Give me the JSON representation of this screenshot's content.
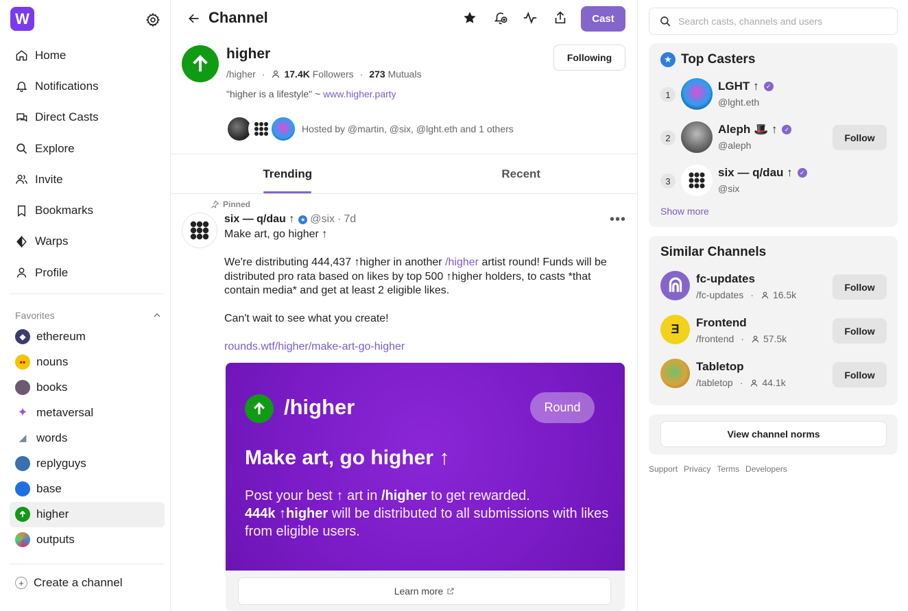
{
  "app": {
    "logo_letter": "W",
    "brand_color": "#7c3aed",
    "accent": "#8465cb"
  },
  "sidebar": {
    "nav": [
      {
        "label": "Home",
        "icon": "home-icon"
      },
      {
        "label": "Notifications",
        "icon": "bell-icon"
      },
      {
        "label": "Direct Casts",
        "icon": "chat-icon"
      },
      {
        "label": "Explore",
        "icon": "search-icon"
      },
      {
        "label": "Invite",
        "icon": "users-icon"
      },
      {
        "label": "Bookmarks",
        "icon": "bookmark-icon"
      },
      {
        "label": "Warps",
        "icon": "warps-icon"
      },
      {
        "label": "Profile",
        "icon": "user-icon"
      }
    ],
    "favorites_label": "Favorites",
    "favorites": [
      {
        "label": "ethereum",
        "color": "#3c3c6e"
      },
      {
        "label": "nouns",
        "color": "#f5c400"
      },
      {
        "label": "books",
        "color": "#6b5a70"
      },
      {
        "label": "metaversal",
        "color": "#9b59d6"
      },
      {
        "label": "words",
        "color": "#c9d2dc"
      },
      {
        "label": "replyguys",
        "color": "#3a6fb0"
      },
      {
        "label": "base",
        "color": "#1f6fe0"
      },
      {
        "label": "higher",
        "color": "#119a13"
      },
      {
        "label": "outputs",
        "color": "#d98a3a"
      }
    ],
    "create_label": "Create a channel"
  },
  "topbar": {
    "title": "Channel",
    "cast_label": "Cast"
  },
  "channel": {
    "name": "higher",
    "slug": "/higher",
    "followers_count": "17.4K",
    "followers_label": "Followers",
    "mutuals_count": "273",
    "mutuals_label": "Mutuals",
    "description": "\"higher is a lifestyle\" ~",
    "link": "www.higher.party",
    "following_label": "Following",
    "hosted_by": "Hosted by @martin, @six, @lght.eth and 1 others"
  },
  "tabs": [
    "Trending",
    "Recent"
  ],
  "post": {
    "pinned_label": "Pinned",
    "author": "six — q/dau ↑",
    "handle": "@six",
    "age": "7d",
    "line1": "Make art, go higher ↑",
    "para1_a": "We're distributing 444,437 ↑higher in another ",
    "para1_link": "/higher",
    "para1_b": " artist round! Funds will be distributed pro rata based on likes by top 500 ↑higher holders, to casts *that contain media* and get at least 2 eligible likes.",
    "para2": "Can't wait to see what you create!",
    "url": "rounds.wtf/higher/make-art-go-higher",
    "embed": {
      "channel": "/higher",
      "pill": "Round",
      "headline": "Make art, go higher ↑",
      "text_a": "Post your best ↑ art in ",
      "text_b": "/higher",
      "text_c": " to get rewarded.",
      "text_d": "444k ↑higher",
      "text_e": " will be distributed to all submissions with likes from eligible users.",
      "learn_more": "Learn more"
    }
  },
  "right": {
    "search_placeholder": "Search casts, channels and users",
    "top_casters_title": "Top Casters",
    "casters": [
      {
        "rank": "1",
        "name": "LGHT ↑",
        "handle": "@lght.eth",
        "color": "#3a4fc8"
      },
      {
        "rank": "2",
        "name": "Aleph 🎩 ↑",
        "handle": "@aleph",
        "color": "#7a7a7a",
        "follow": "Follow"
      },
      {
        "rank": "3",
        "name": "six — q/dau ↑",
        "handle": "@six",
        "color": "#ffffff"
      }
    ],
    "show_more": "Show more",
    "similar_title": "Similar Channels",
    "similar": [
      {
        "name": "fc-updates",
        "slug": "/fc-updates",
        "count": "16.5k",
        "color": "#8465cb",
        "follow": "Follow"
      },
      {
        "name": "Frontend",
        "slug": "/frontend",
        "count": "57.5k",
        "color": "#f2d21a",
        "follow": "Follow"
      },
      {
        "name": "Tabletop",
        "slug": "/tabletop",
        "count": "44.1k",
        "color": "#d9a33a",
        "follow": "Follow"
      }
    ],
    "norms_label": "View channel norms",
    "footer": [
      "Support",
      "Privacy",
      "Terms",
      "Developers"
    ]
  }
}
